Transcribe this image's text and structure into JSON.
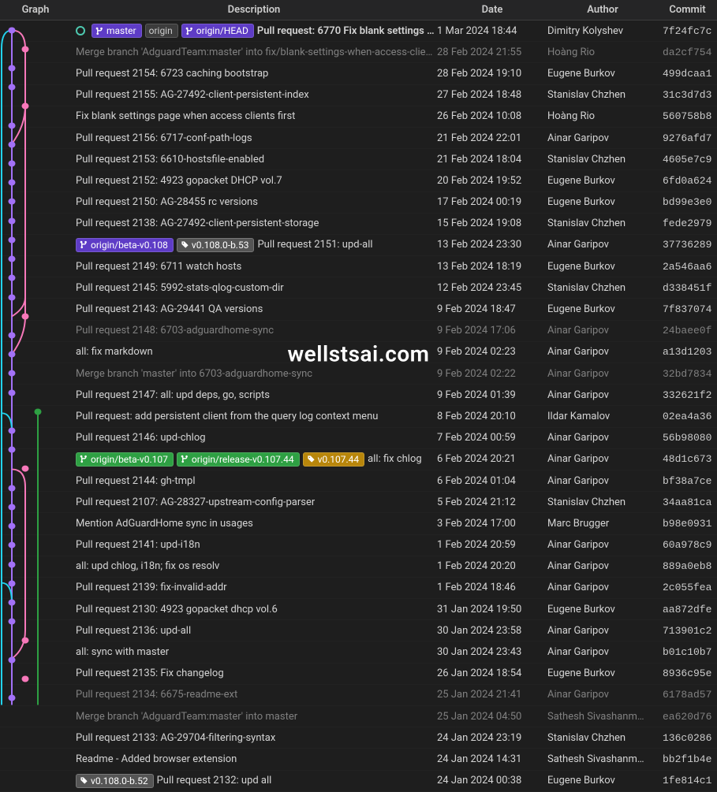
{
  "header": {
    "graph": "Graph",
    "description": "Description",
    "date": "Date",
    "author": "Author",
    "commit": "Commit"
  },
  "watermark": "wellstsai.com",
  "commits": [
    {
      "badges": [
        {
          "cls": "badge-purple",
          "icon": "branch",
          "label": "master"
        },
        {
          "cls": "badge-gray",
          "label": "origin"
        },
        {
          "cls": "badge-purple",
          "icon": "branch",
          "label": "origin/HEAD"
        }
      ],
      "ring": true,
      "desc": "Pull request: 6770 Fix blank settings …",
      "bold": true,
      "date": "1 Mar 2024 18:44",
      "author": "Dimitry Kolyshev",
      "commit": "7f24fc7c"
    },
    {
      "dim": true,
      "desc": "Merge branch 'AdguardTeam:master' into fix/blank-settings-when-access-clients…",
      "date": "28 Feb 2024 21:55",
      "author": "Hoàng Rio",
      "commit": "da2cf754"
    },
    {
      "desc": "Pull request 2154: 6723 caching bootstrap",
      "date": "28 Feb 2024 19:10",
      "author": "Eugene Burkov",
      "commit": "499dcaa1"
    },
    {
      "desc": "Pull request 2155: AG-27492-client-persistent-index",
      "date": "27 Feb 2024 18:48",
      "author": "Stanislav Chzhen",
      "commit": "31c3d7d3"
    },
    {
      "desc": "Fix blank settings page when access clients first",
      "date": "26 Feb 2024 10:08",
      "author": "Hoàng Rio",
      "commit": "560758b8"
    },
    {
      "desc": "Pull request 2156: 6717-conf-path-logs",
      "date": "21 Feb 2024 22:01",
      "author": "Ainar Garipov",
      "commit": "9276afd7"
    },
    {
      "desc": "Pull request 2153: 6610-hostsfile-enabled",
      "date": "21 Feb 2024 18:04",
      "author": "Stanislav Chzhen",
      "commit": "4605e7c9"
    },
    {
      "desc": "Pull request 2152: 4923 gopacket DHCP vol.7",
      "date": "20 Feb 2024 19:52",
      "author": "Eugene Burkov",
      "commit": "6fd0a624"
    },
    {
      "desc": "Pull request 2150: AG-28455 rc versions",
      "date": "17 Feb 2024 00:19",
      "author": "Eugene Burkov",
      "commit": "bd99e3e0"
    },
    {
      "desc": "Pull request 2138: AG-27492-client-persistent-storage",
      "date": "15 Feb 2024 19:08",
      "author": "Stanislav Chzhen",
      "commit": "fede2979"
    },
    {
      "badges": [
        {
          "cls": "badge-purple",
          "icon": "branch",
          "label": "origin/beta-v0.108"
        },
        {
          "cls": "badge-tag",
          "icon": "tag",
          "label": "v0.108.0-b.53"
        }
      ],
      "desc": "Pull request 2151: upd-all",
      "date": "13 Feb 2024 23:30",
      "author": "Ainar Garipov",
      "commit": "37736289"
    },
    {
      "desc": "Pull request 2149: 6711 watch hosts",
      "date": "13 Feb 2024 18:19",
      "author": "Eugene Burkov",
      "commit": "2a546aa6"
    },
    {
      "desc": "Pull request 2145: 5992-stats-qlog-custom-dir",
      "date": "12 Feb 2024 23:45",
      "author": "Stanislav Chzhen",
      "commit": "d338451f"
    },
    {
      "desc": "Pull request 2143: AG-29441 QA versions",
      "date": "9 Feb 2024 18:47",
      "author": "Eugene Burkov",
      "commit": "7f837074"
    },
    {
      "dim": true,
      "desc": "Pull request 2148: 6703-adguardhome-sync",
      "date": "9 Feb 2024 17:06",
      "author": "Ainar Garipov",
      "commit": "24baee0f"
    },
    {
      "desc": "all: fix markdown",
      "date": "9 Feb 2024 02:23",
      "author": "Ainar Garipov",
      "commit": "a13d1203"
    },
    {
      "dim": true,
      "desc": "Merge branch 'master' into 6703-adguardhome-sync",
      "date": "9 Feb 2024 02:22",
      "author": "Ainar Garipov",
      "commit": "32bd7834"
    },
    {
      "desc": "Pull request 2147: all: upd deps, go, scripts",
      "date": "9 Feb 2024 01:39",
      "author": "Ainar Garipov",
      "commit": "332621f2"
    },
    {
      "desc": "Pull request: add persistent client from the query log context menu",
      "date": "8 Feb 2024 20:10",
      "author": "Ildar Kamalov",
      "commit": "02ea4a36"
    },
    {
      "desc": "Pull request 2146: upd-chlog",
      "date": "7 Feb 2024 00:59",
      "author": "Ainar Garipov",
      "commit": "56b98080"
    },
    {
      "badges": [
        {
          "cls": "badge-green",
          "icon": "branch",
          "label": "origin/beta-v0.107"
        },
        {
          "cls": "badge-green",
          "icon": "branch",
          "label": "origin/release-v0.107.44"
        },
        {
          "cls": "badge-tag-orange",
          "icon": "tag",
          "label": "v0.107.44"
        }
      ],
      "desc": "all: fix chlog",
      "date": "6 Feb 2024 20:21",
      "author": "Ainar Garipov",
      "commit": "48d1c673"
    },
    {
      "desc": "Pull request 2144: gh-tmpl",
      "date": "6 Feb 2024 01:04",
      "author": "Ainar Garipov",
      "commit": "bf38a7ce"
    },
    {
      "desc": "Pull request 2107: AG-28327-upstream-config-parser",
      "date": "5 Feb 2024 21:12",
      "author": "Stanislav Chzhen",
      "commit": "34aa81ca"
    },
    {
      "desc": "Mention AdGuardHome sync in usages",
      "date": "3 Feb 2024 17:00",
      "author": "Marc Brugger",
      "commit": "b98e0931"
    },
    {
      "desc": "Pull request 2141: upd-i18n",
      "date": "1 Feb 2024 20:59",
      "author": "Ainar Garipov",
      "commit": "60a978c9"
    },
    {
      "desc": "all: upd chlog, i18n; fix os resolv",
      "date": "1 Feb 2024 20:20",
      "author": "Ainar Garipov",
      "commit": "889a0eb8"
    },
    {
      "desc": "Pull request 2139: fix-invalid-addr",
      "date": "1 Feb 2024 18:46",
      "author": "Ainar Garipov",
      "commit": "2c055fea"
    },
    {
      "desc": "Pull request 2130: 4923 gopacket dhcp vol.6",
      "date": "31 Jan 2024 19:50",
      "author": "Eugene Burkov",
      "commit": "aa872dfe"
    },
    {
      "desc": "Pull request 2136: upd-all",
      "date": "30 Jan 2024 23:58",
      "author": "Ainar Garipov",
      "commit": "713901c2"
    },
    {
      "desc": "all: sync with master",
      "date": "30 Jan 2024 23:43",
      "author": "Ainar Garipov",
      "commit": "b01c10b7"
    },
    {
      "desc": "Pull request 2135: Fix changelog",
      "date": "26 Jan 2024 18:54",
      "author": "Eugene Burkov",
      "commit": "8936c95e"
    },
    {
      "dim": true,
      "desc": "Pull request 2134: 6675-readme-ext",
      "date": "25 Jan 2024 21:41",
      "author": "Ainar Garipov",
      "commit": "6178ad57"
    },
    {
      "dim": true,
      "desc": "Merge branch 'AdguardTeam:master' into master",
      "date": "25 Jan 2024 04:50",
      "author": "Sathesh Sivashanm…",
      "commit": "ea620d76"
    },
    {
      "desc": "Pull request 2133: AG-29704-filtering-syntax",
      "date": "24 Jan 2024 23:19",
      "author": "Stanislav Chzhen",
      "commit": "136c0286"
    },
    {
      "desc": "Readme - Added browser extension",
      "date": "24 Jan 2024 14:31",
      "author": "Sathesh Sivashanm…",
      "commit": "bb2f1b4e"
    },
    {
      "badges": [
        {
          "cls": "badge-tag",
          "icon": "tag",
          "label": "v0.108.0-b.52"
        }
      ],
      "desc": "Pull request 2132: upd all",
      "date": "24 Jan 2024 00:38",
      "author": "Eugene Burkov",
      "commit": "1fe814c1"
    }
  ]
}
